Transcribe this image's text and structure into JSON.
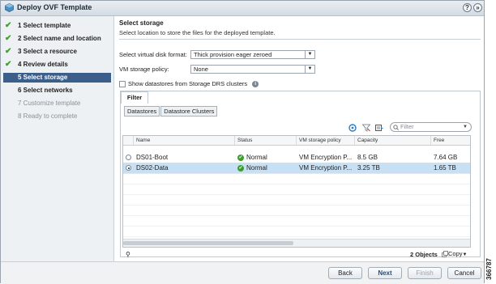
{
  "window": {
    "title": "Deploy OVF Template",
    "help_label": "?",
    "close_label": "»"
  },
  "steps": [
    {
      "label": "1  Select template",
      "state": "done"
    },
    {
      "label": "2  Select name and location",
      "state": "done"
    },
    {
      "label": "3  Select a resource",
      "state": "done"
    },
    {
      "label": "4  Review details",
      "state": "done"
    },
    {
      "label": "5  Select storage",
      "state": "active"
    },
    {
      "label": "6  Select networks",
      "state": "pending"
    },
    {
      "label": "7  Customize template",
      "state": "disabled"
    },
    {
      "label": "8  Ready to complete",
      "state": "disabled"
    }
  ],
  "main": {
    "title": "Select storage",
    "subtitle": "Select location to store the files for the deployed template.",
    "disk_format_label": "Select virtual disk format:",
    "disk_format_value": "Thick provision eager zeroed",
    "storage_policy_label": "VM storage policy:",
    "storage_policy_value": "None",
    "show_drs_label": "Show datastores from Storage DRS clusters"
  },
  "tabs": {
    "filter": "Filter",
    "sub": [
      "Datastores",
      "Datastore Clusters"
    ]
  },
  "filter_placeholder": "Filter",
  "table": {
    "columns": [
      "Name",
      "Status",
      "VM storage policy",
      "Capacity",
      "Free"
    ],
    "rows": [
      {
        "name": "DS01-Boot",
        "status": "Normal",
        "policy": "VM Encryption P...",
        "capacity": "8.5  GB",
        "free": "7.64  GB",
        "selected": false
      },
      {
        "name": "DS02-Data",
        "status": "Normal",
        "policy": "VM Encryption P...",
        "capacity": "3.25  TB",
        "free": "1.65  TB",
        "selected": true
      }
    ],
    "count": "2 Objects",
    "copy_label": "Copy"
  },
  "buttons": {
    "back": "Back",
    "next": "Next",
    "finish": "Finish",
    "cancel": "Cancel"
  },
  "figure_code": "366787",
  "colors": {
    "active_step": "#3b5f8a",
    "selected_row": "#c7e0f4",
    "ok_green": "#3c9d2e"
  }
}
